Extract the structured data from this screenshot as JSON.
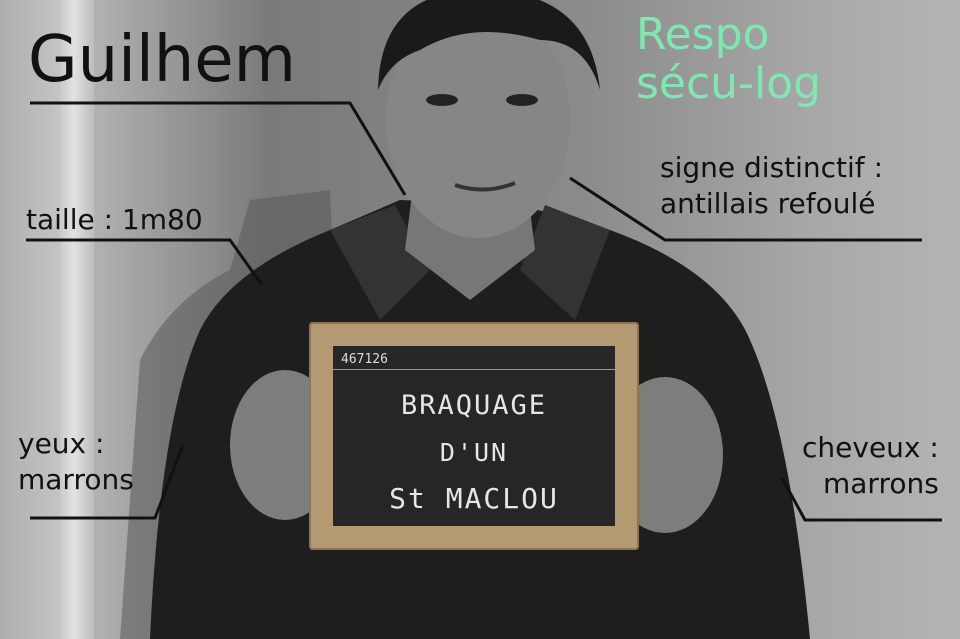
{
  "annotations": {
    "name": "Guilhem",
    "role": [
      "Respo",
      "sécu-log"
    ],
    "distinctive_sign": [
      "signe distinctif :",
      "antillais refoulé"
    ],
    "height": "taille : 1m80",
    "eyes": [
      "yeux :",
      "marrons"
    ],
    "hair": [
      "cheveux :",
      "marrons"
    ]
  },
  "slate": {
    "number": "467126",
    "lines": [
      "BRAQUAGE",
      "D'UN",
      "St MACLOU"
    ]
  },
  "colors": {
    "role_text": "#7ee8b3",
    "caption_text": "#111111",
    "slate_board": "#262626",
    "slate_frame": "#b49a73"
  }
}
